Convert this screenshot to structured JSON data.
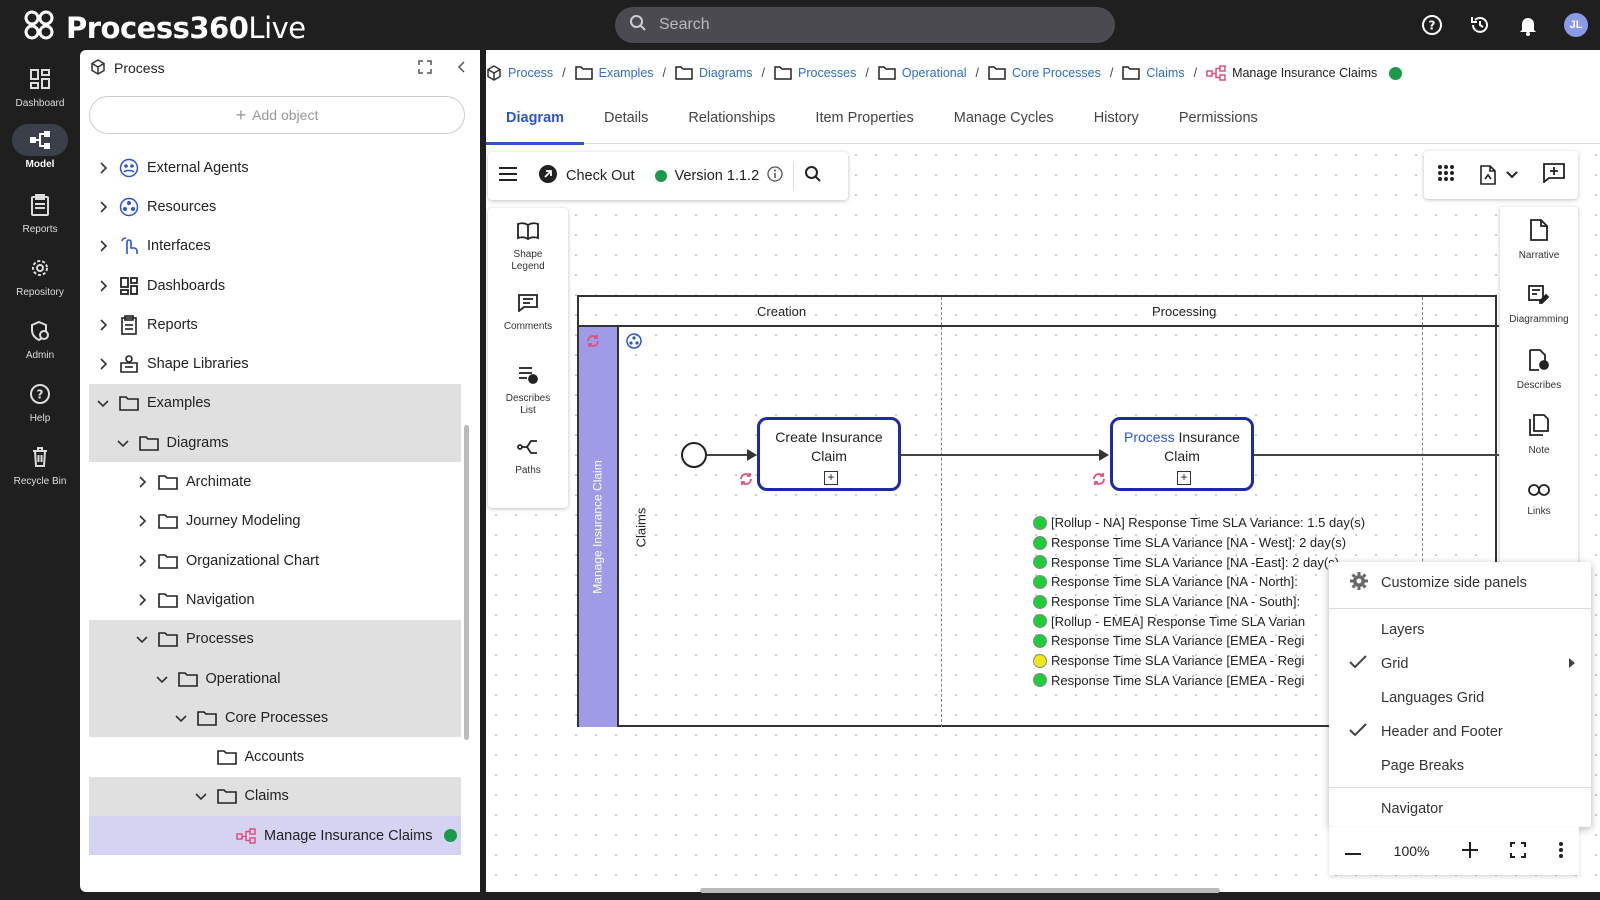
{
  "app": {
    "name_bold": "Process360",
    "name_light": "Live"
  },
  "search": {
    "placeholder": "Search"
  },
  "user": {
    "initials": "JL"
  },
  "nav": [
    {
      "label": "Dashboard",
      "icon": "dashboard-icon"
    },
    {
      "label": "Model",
      "icon": "model-icon",
      "active": true
    },
    {
      "label": "Reports",
      "icon": "reports-icon"
    },
    {
      "label": "Repository",
      "icon": "gear-icon"
    },
    {
      "label": "Admin",
      "icon": "admin-icon"
    },
    {
      "label": "Help",
      "icon": "help-icon"
    },
    {
      "label": "Recycle Bin",
      "icon": "trash-icon"
    }
  ],
  "panel": {
    "title": "Process",
    "add_object": "Add object",
    "tree": [
      {
        "label": "External Agents",
        "depth": 0,
        "chev": "right"
      },
      {
        "label": "Resources",
        "depth": 0,
        "chev": "right"
      },
      {
        "label": "Interfaces",
        "depth": 0,
        "chev": "right"
      },
      {
        "label": "Dashboards",
        "depth": 0,
        "chev": "right"
      },
      {
        "label": "Reports",
        "depth": 0,
        "chev": "right"
      },
      {
        "label": "Shape Libraries",
        "depth": 0,
        "chev": "right"
      },
      {
        "label": "Examples",
        "depth": 0,
        "chev": "down"
      },
      {
        "label": "Diagrams",
        "depth": 1,
        "chev": "down"
      },
      {
        "label": "Archimate",
        "depth": 2,
        "chev": "right"
      },
      {
        "label": "Journey Modeling",
        "depth": 2,
        "chev": "right"
      },
      {
        "label": "Organizational Chart",
        "depth": 2,
        "chev": "right"
      },
      {
        "label": "Navigation",
        "depth": 2,
        "chev": "right"
      },
      {
        "label": "Processes",
        "depth": 2,
        "chev": "down"
      },
      {
        "label": "Operational",
        "depth": 3,
        "chev": "down"
      },
      {
        "label": "Core Processes",
        "depth": 4,
        "chev": "down"
      },
      {
        "label": "Accounts",
        "depth": 5,
        "chev": "none"
      },
      {
        "label": "Claims",
        "depth": 5,
        "chev": "down"
      },
      {
        "label": "Manage Insurance Claims",
        "depth": 6,
        "chev": "none"
      }
    ]
  },
  "breadcrumb": [
    "Process",
    "Examples",
    "Diagrams",
    "Processes",
    "Operational",
    "Core Processes",
    "Claims"
  ],
  "breadcrumb_current": "Manage Insurance Claims",
  "tabs": [
    "Diagram",
    "Details",
    "Relationships",
    "Item Properties",
    "Manage Cycles",
    "History",
    "Permissions"
  ],
  "toolbar": {
    "checkout": "Check Out",
    "version": "Version 1.1.2"
  },
  "left_tools": [
    "Shape Legend",
    "Comments",
    "Describes List",
    "Paths"
  ],
  "right_tools": [
    "Narrative",
    "Diagramming",
    "Describes",
    "Note",
    "Links"
  ],
  "diagram": {
    "phases": [
      "Creation",
      "Processing"
    ],
    "pool": "Manage Insurance Claim",
    "lane": "Claims",
    "task1": "Create Insurance Claim",
    "task2_link": "Process",
    "task2_rest": " Insurance Claim",
    "kpis": [
      {
        "text": "[Rollup - NA] Response Time SLA Variance: 1.5 day(s)",
        "color": "#1fcc3a"
      },
      {
        "text": "Response Time SLA Variance [NA - West]: 2 day(s)",
        "color": "#1fcc3a"
      },
      {
        "text": "Response Time SLA Variance [NA -East]: 2 day(s)",
        "color": "#1fcc3a"
      },
      {
        "text": "Response Time SLA Variance [NA - North]:",
        "color": "#1fcc3a"
      },
      {
        "text": "Response Time SLA Variance [NA - South]:",
        "color": "#1fcc3a"
      },
      {
        "text": "[Rollup - EMEA] Response Time SLA Varian",
        "color": "#1fcc3a"
      },
      {
        "text": "Response Time SLA Variance [EMEA - Regi",
        "color": "#1fcc3a"
      },
      {
        "text": "Response Time SLA Variance [EMEA - Regi",
        "color": "#f0e61a"
      },
      {
        "text": "Response Time SLA Variance [EMEA - Regi",
        "color": "#1fcc3a"
      }
    ]
  },
  "menu": {
    "customize": "Customize side panels",
    "items": [
      {
        "label": "Layers",
        "checked": false
      },
      {
        "label": "Grid",
        "checked": true,
        "submenu": true
      },
      {
        "label": "Languages Grid",
        "checked": false
      },
      {
        "label": "Header and Footer",
        "checked": true
      },
      {
        "label": "Page Breaks",
        "checked": false
      }
    ],
    "navigator": "Navigator"
  },
  "zoom": {
    "level": "100%"
  }
}
